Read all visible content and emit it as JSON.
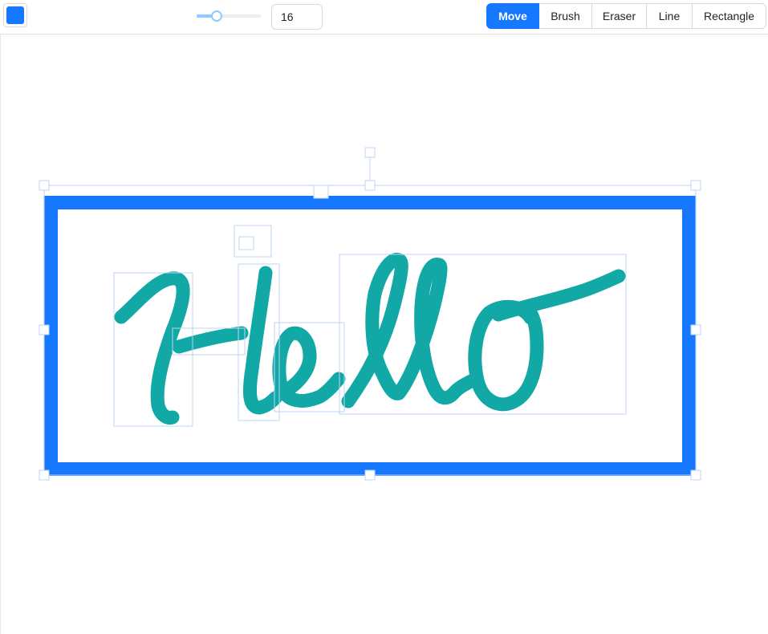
{
  "toolbar": {
    "color_label": "stroke-color",
    "color": "#1677ff",
    "brush_size": "16",
    "slider_value_percent": 30,
    "modes": [
      {
        "label": "Move",
        "active": true
      },
      {
        "label": "Brush",
        "active": false
      },
      {
        "label": "Eraser",
        "active": false
      },
      {
        "label": "Line",
        "active": false
      },
      {
        "label": "Rectangle",
        "active": false
      }
    ]
  },
  "canvas": {
    "rectangle_stroke_color": "#1677ff",
    "brush_stroke_color": "#12a8a6",
    "selection_color": "#bcd3f5",
    "handwriting_text": "Hello"
  }
}
